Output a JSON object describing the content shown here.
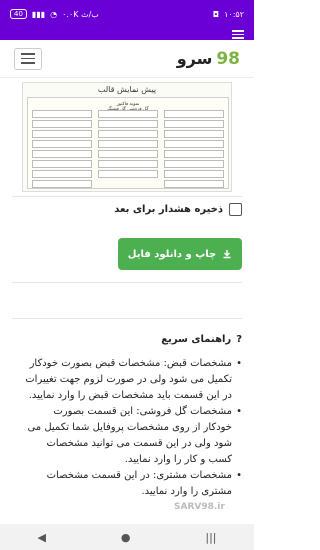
{
  "status": {
    "battery": "40",
    "network": "۰.۰K ب/ث",
    "time": "۱۰:۵۲"
  },
  "header": {
    "brand_text": "سرو",
    "brand_number": "98"
  },
  "preview": {
    "title": "پیش نمایش قالب",
    "shop_line1": "گل فروشی گل قشنگ",
    "shop_line2": "نمونه فاکتور"
  },
  "save_warning": {
    "label": "ذخیره هشدار برای بعد"
  },
  "print_button": {
    "label": "چاپ و دانلود فایل"
  },
  "guide": {
    "title": "راهنمای سریع",
    "items": [
      "مشخصات قبض: مشخصات قبض بصورت خودکار تکمیل می شود ولی در صورت لزوم جهت تغییرات در این قسمت باید مشخصات قبض را وارد نمایید.",
      "مشخصات گل فروشی: این قسمت بصورت خودکار از روی مشخصات پروفایل شما تکمیل می شود ولی در این قسمت می توانید مشخصات کسب و کار را وارد نمایید.",
      "مشخصات مشتری: در این قسمت مشخصات مشتری را وارد نمایید."
    ]
  },
  "watermark": "SARV98.ir"
}
